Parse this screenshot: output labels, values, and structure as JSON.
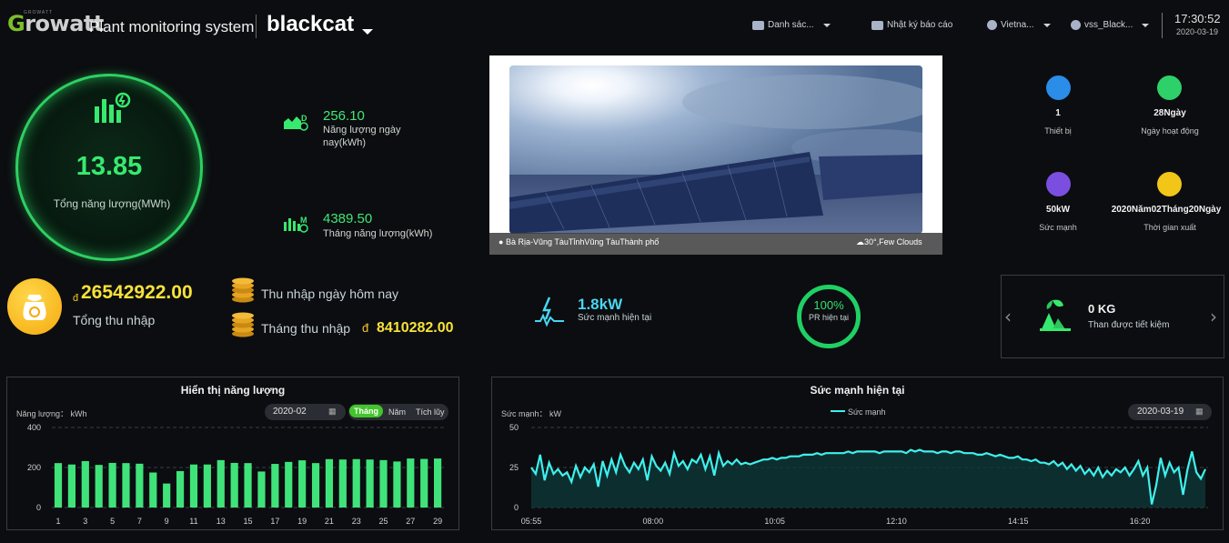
{
  "header": {
    "logo_g": "G",
    "logo_rest": "rowatt",
    "logo_sub": "GROWATT",
    "system_title": "Plant monitoring system",
    "plant_name": "blackcat",
    "menu_list": "Danh sác...",
    "menu_log": "Nhật ký báo cáo",
    "menu_lang": "Vietna...",
    "menu_user": "vss_Black...",
    "clock": "17:30:52",
    "date": "2020-03-19"
  },
  "energy": {
    "total_value": "13.85",
    "total_label": "Tổng năng lượng(MWh)",
    "today_value": "256.10",
    "today_label_1": "Năng lượng ngày",
    "today_label_2": "nay(kWh)",
    "month_value": "4389.50",
    "month_label": "Tháng năng lượng(kWh)"
  },
  "photo": {
    "location": "Bà Rịa-Vũng TàuTỉnhVũng TàuThành phố",
    "weather": "30°,Few Clouds"
  },
  "info": {
    "devices_value": "1",
    "devices_label": "Thiết bị",
    "days_value": "28Ngày",
    "days_label": "Ngày hoạt động",
    "power_value": "50kW",
    "power_label": "Sức mạnh",
    "since_value": "2020Năm02Tháng20Ngày",
    "since_label": "Thời gian xuất"
  },
  "income": {
    "currency": "đ",
    "total_value": "26542922.00",
    "total_label": "Tổng thu nhập",
    "today_label": "Thu nhập ngày hôm nay",
    "month_label": "Tháng thu nhập",
    "month_value": "8410282.00"
  },
  "current": {
    "power_value": "1.8kW",
    "power_label": "Sức mạnh hiện tại",
    "pr_value": "100%",
    "pr_label": "PR hiện tại"
  },
  "coal": {
    "value": "0 KG",
    "label": "Than được tiết kiệm"
  },
  "colors": {
    "accent_green": "#37e96f",
    "gold": "#f7e23a",
    "cyan": "#3ef0ec",
    "bar_green": "#3fe37a"
  },
  "energy_panel": {
    "title": "Hiển thị năng lượng",
    "unit": "Năng lượng： kWh",
    "month": "2020-02",
    "tab_month": "Tháng",
    "tab_year": "Năm",
    "tab_total": "Tích lũy"
  },
  "power_panel": {
    "title": "Sức mạnh hiện tại",
    "unit": "Sức mạnh： kW",
    "legend": "Sức mạnh",
    "date": "2020-03-19"
  },
  "chart_data": [
    {
      "type": "bar",
      "title": "Hiển thị năng lượng",
      "ylabel": "Năng lượng： kWh",
      "ylim": [
        0,
        400
      ],
      "yticks": [
        0,
        200,
        400
      ],
      "categories": [
        "1",
        "2",
        "3",
        "4",
        "5",
        "6",
        "7",
        "8",
        "9",
        "10",
        "11",
        "12",
        "13",
        "14",
        "15",
        "16",
        "17",
        "18",
        "19",
        "20",
        "21",
        "22",
        "23",
        "24",
        "25",
        "26",
        "27",
        "28",
        "29"
      ],
      "xtick_labels": [
        "1",
        "3",
        "5",
        "7",
        "9",
        "11",
        "13",
        "15",
        "17",
        "19",
        "21",
        "23",
        "25",
        "27",
        "29"
      ],
      "values": [
        222,
        215,
        232,
        213,
        223,
        222,
        219,
        175,
        120,
        182,
        215,
        215,
        237,
        223,
        222,
        180,
        218,
        228,
        236,
        222,
        242,
        240,
        242,
        240,
        237,
        230,
        245,
        243,
        245
      ],
      "grid": true
    },
    {
      "type": "area",
      "title": "Sức mạnh hiện tại",
      "ylabel": "Sức mạnh： kW",
      "series": [
        {
          "name": "Sức mạnh"
        }
      ],
      "ylim": [
        0,
        50
      ],
      "yticks": [
        0,
        25,
        50
      ],
      "xtick_labels": [
        "05:55",
        "08:00",
        "10:05",
        "12:10",
        "14:15",
        "16:20"
      ],
      "x_start": "05:55",
      "x_end": "17:30",
      "values": [
        25,
        21,
        33,
        17,
        28,
        21,
        24,
        20,
        22,
        16,
        26,
        19,
        25,
        22,
        27,
        13,
        29,
        20,
        30,
        22,
        33,
        26,
        22,
        28,
        24,
        30,
        17,
        32,
        26,
        23,
        28,
        21,
        34,
        26,
        29,
        24,
        30,
        28,
        33,
        24,
        32,
        20,
        34,
        26,
        29,
        27,
        30,
        27,
        28,
        27,
        28,
        29,
        30,
        30,
        31,
        30,
        31,
        31,
        32,
        32,
        32,
        33,
        33,
        33,
        34,
        33,
        34,
        34,
        34,
        34,
        34,
        35,
        34,
        35,
        35,
        35,
        35,
        35,
        34,
        35,
        35,
        35,
        35,
        35,
        34,
        36,
        35,
        36,
        35,
        35,
        35,
        34,
        35,
        35,
        34,
        35,
        35,
        34,
        34,
        34,
        33,
        33,
        34,
        33,
        32,
        33,
        32,
        31,
        31,
        32,
        30,
        30,
        29,
        30,
        28,
        28,
        27,
        29,
        26,
        28,
        24,
        27,
        23,
        26,
        21,
        24,
        20,
        25,
        19,
        23,
        20,
        24,
        22,
        25,
        20,
        24,
        29,
        20,
        25,
        2,
        14,
        31,
        20,
        28,
        22,
        25,
        8,
        24,
        35,
        22,
        18,
        24
      ],
      "grid": true
    }
  ]
}
